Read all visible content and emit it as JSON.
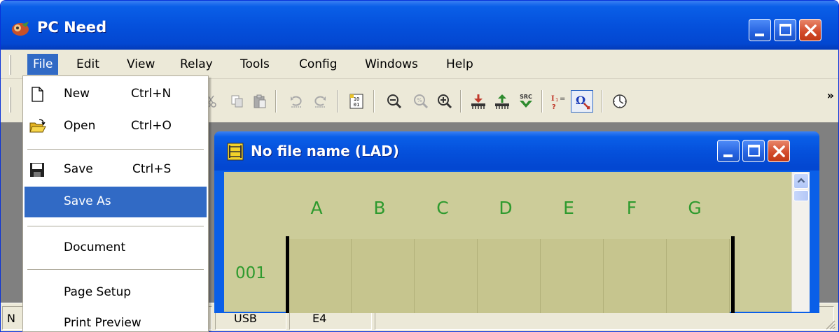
{
  "app": {
    "title": "PC Need"
  },
  "menubar": {
    "items": [
      {
        "label": "File"
      },
      {
        "label": "Edit"
      },
      {
        "label": "View"
      },
      {
        "label": "Relay"
      },
      {
        "label": "Tools"
      },
      {
        "label": "Config"
      },
      {
        "label": "Windows"
      },
      {
        "label": "Help"
      }
    ]
  },
  "toolbar": {
    "buttons": [
      "cut-icon",
      "copy-icon",
      "paste-icon",
      "undo-icon",
      "redo-icon",
      "binary-view-icon",
      "zoom-out-icon",
      "zoom-reset-icon",
      "zoom-in-icon",
      "download-to-relay-icon",
      "upload-from-relay-icon",
      "source-icon",
      "input-query-icon",
      "online-monitor-icon",
      "timer-icon"
    ],
    "more": "»"
  },
  "file_menu": {
    "items": [
      {
        "label": "New",
        "shortcut": "Ctrl+N",
        "icon": "new-file-icon"
      },
      {
        "label": "Open",
        "shortcut": "Ctrl+O",
        "icon": "open-folder-icon"
      },
      {
        "label": "Save",
        "shortcut": "Ctrl+S",
        "icon": "floppy-disk-icon"
      },
      {
        "label": "Save As",
        "shortcut": ""
      },
      {
        "label": "Document",
        "shortcut": ""
      },
      {
        "label": "Page Setup",
        "shortcut": ""
      },
      {
        "label": "Print Preview",
        "shortcut": ""
      }
    ],
    "highlighted": "Save As"
  },
  "child_window": {
    "title": "No file name (LAD)",
    "columns": [
      "A",
      "B",
      "C",
      "D",
      "E",
      "F",
      "G"
    ],
    "rung": "001"
  },
  "statusbar": {
    "cells": [
      "N",
      "USB",
      "E4",
      ""
    ]
  },
  "colors": {
    "title_blue": "#0a5fe8",
    "menu_highlight": "#316ac5",
    "ladder_bg": "#cccc99",
    "ladder_text": "#2e9a2e"
  }
}
